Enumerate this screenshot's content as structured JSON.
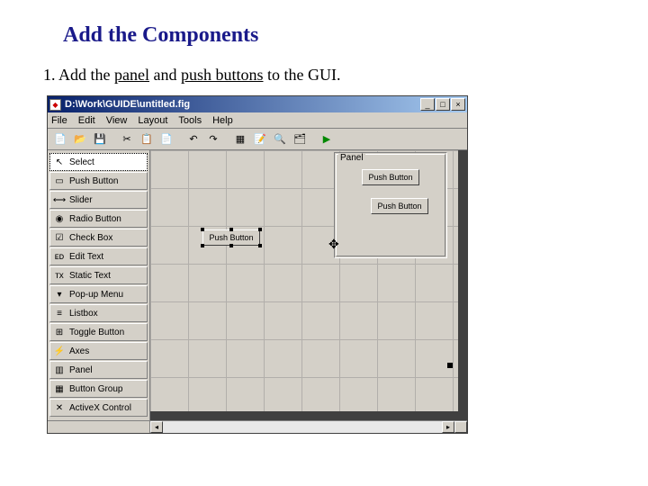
{
  "heading": "Add the Components",
  "step_prefix": "1. Add the ",
  "step_panel": "panel",
  "step_and": " and ",
  "step_pb": "push buttons",
  "step_suffix": " to the GUI.",
  "window": {
    "title": "D:\\Work\\GUIDE\\untitled.fig",
    "icon_glyph": "◆"
  },
  "menu": {
    "file": "File",
    "edit": "Edit",
    "view": "View",
    "layout": "Layout",
    "tools": "Tools",
    "help": "Help"
  },
  "palette": [
    {
      "icon": "↖",
      "label": "Select"
    },
    {
      "icon": "▭",
      "label": "Push Button"
    },
    {
      "icon": "⟷",
      "label": "Slider"
    },
    {
      "icon": "◉",
      "label": "Radio Button"
    },
    {
      "icon": "☑",
      "label": "Check Box"
    },
    {
      "icon": "ᴇᴅ",
      "label": "Edit Text"
    },
    {
      "icon": "ᴛx",
      "label": "Static Text"
    },
    {
      "icon": "▾",
      "label": "Pop-up Menu"
    },
    {
      "icon": "≡",
      "label": "Listbox"
    },
    {
      "icon": "⊞",
      "label": "Toggle Button"
    },
    {
      "icon": "⚡",
      "label": "Axes"
    },
    {
      "icon": "▥",
      "label": "Panel"
    },
    {
      "icon": "▦",
      "label": "Button Group"
    },
    {
      "icon": "✕",
      "label": "ActiveX Control"
    }
  ],
  "panel": {
    "label": "Panel",
    "btn1": "Push Button",
    "btn2": "Push Button"
  },
  "drag_button": "Push Button",
  "winbtns": {
    "min": "_",
    "max": "□",
    "close": "×"
  }
}
